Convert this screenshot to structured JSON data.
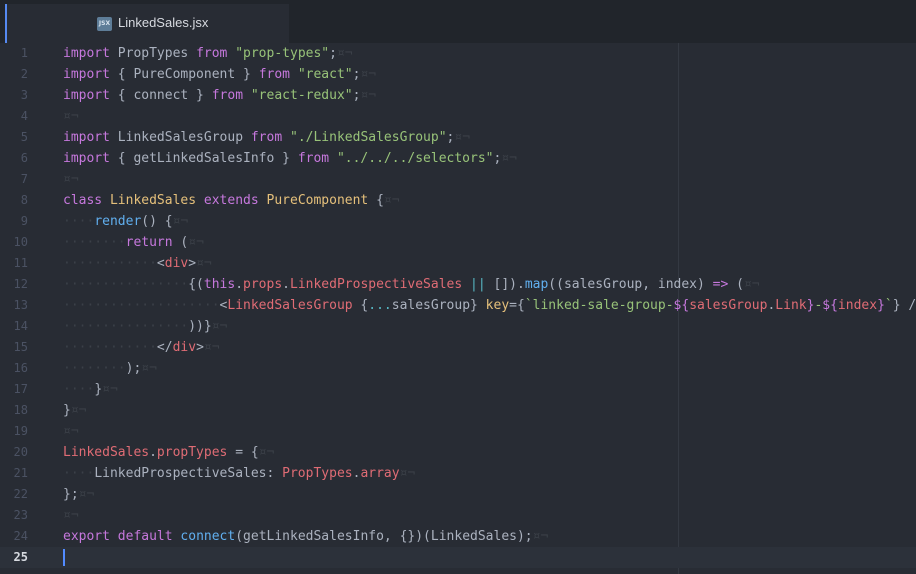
{
  "tab": {
    "icon_label": "JSX",
    "filename": "LinkedSales.jsx"
  },
  "editor": {
    "active_line": 25,
    "lines": [
      {
        "n": "1",
        "tokens": [
          [
            "k",
            "import"
          ],
          [
            "p",
            " PropTypes "
          ],
          [
            "k",
            "from"
          ],
          [
            "p",
            " "
          ],
          [
            "s",
            "\"prop-types\""
          ],
          [
            "p",
            ";"
          ],
          [
            "ws",
            "¤¬"
          ]
        ]
      },
      {
        "n": "2",
        "tokens": [
          [
            "k",
            "import"
          ],
          [
            "p",
            " { PureComponent } "
          ],
          [
            "k",
            "from"
          ],
          [
            "p",
            " "
          ],
          [
            "s",
            "\"react\""
          ],
          [
            "p",
            ";"
          ],
          [
            "ws",
            "¤¬"
          ]
        ]
      },
      {
        "n": "3",
        "tokens": [
          [
            "k",
            "import"
          ],
          [
            "p",
            " { connect } "
          ],
          [
            "k",
            "from"
          ],
          [
            "p",
            " "
          ],
          [
            "s",
            "\"react-redux\""
          ],
          [
            "p",
            ";"
          ],
          [
            "ws",
            "¤¬"
          ]
        ]
      },
      {
        "n": "4",
        "tokens": [
          [
            "ws",
            "¤¬"
          ]
        ]
      },
      {
        "n": "5",
        "tokens": [
          [
            "k",
            "import"
          ],
          [
            "p",
            " LinkedSalesGroup "
          ],
          [
            "k",
            "from"
          ],
          [
            "p",
            " "
          ],
          [
            "s",
            "\"./LinkedSalesGroup\""
          ],
          [
            "p",
            ";"
          ],
          [
            "ws",
            "¤¬"
          ]
        ]
      },
      {
        "n": "6",
        "tokens": [
          [
            "k",
            "import"
          ],
          [
            "p",
            " { getLinkedSalesInfo } "
          ],
          [
            "k",
            "from"
          ],
          [
            "p",
            " "
          ],
          [
            "s",
            "\"../../../selectors\""
          ],
          [
            "p",
            ";"
          ],
          [
            "ws",
            "¤¬"
          ]
        ]
      },
      {
        "n": "7",
        "tokens": [
          [
            "ws",
            "¤¬"
          ]
        ]
      },
      {
        "n": "8",
        "tokens": [
          [
            "k",
            "class"
          ],
          [
            "p",
            " "
          ],
          [
            "c",
            "LinkedSales"
          ],
          [
            "p",
            " "
          ],
          [
            "k",
            "extends"
          ],
          [
            "p",
            " "
          ],
          [
            "c",
            "PureComponent"
          ],
          [
            "p",
            " {"
          ],
          [
            "ws",
            "¤¬"
          ]
        ]
      },
      {
        "n": "9",
        "tokens": [
          [
            "ws",
            "····"
          ],
          [
            "f",
            "render"
          ],
          [
            "p",
            "() {"
          ],
          [
            "ws",
            "¤¬"
          ]
        ]
      },
      {
        "n": "10",
        "tokens": [
          [
            "ws",
            "········"
          ],
          [
            "k",
            "return"
          ],
          [
            "p",
            " ("
          ],
          [
            "ws",
            "¤¬"
          ]
        ]
      },
      {
        "n": "11",
        "tokens": [
          [
            "ws",
            "············"
          ],
          [
            "p",
            "<"
          ],
          [
            "t",
            "div"
          ],
          [
            "p",
            ">"
          ],
          [
            "ws",
            "¤¬"
          ]
        ]
      },
      {
        "n": "12",
        "tokens": [
          [
            "ws",
            "················"
          ],
          [
            "p",
            "{("
          ],
          [
            "k",
            "this"
          ],
          [
            "p",
            "."
          ],
          [
            "t",
            "props"
          ],
          [
            "p",
            "."
          ],
          [
            "t",
            "LinkedProspectiveSales"
          ],
          [
            "p",
            " "
          ],
          [
            "o",
            "||"
          ],
          [
            "p",
            " [])."
          ],
          [
            "f",
            "map"
          ],
          [
            "p",
            "((salesGroup, index) "
          ],
          [
            "k",
            "=>"
          ],
          [
            "p",
            " ("
          ],
          [
            "ws",
            "¤¬"
          ]
        ]
      },
      {
        "n": "13",
        "tokens": [
          [
            "ws",
            "····················"
          ],
          [
            "p",
            "<"
          ],
          [
            "t",
            "LinkedSalesGroup"
          ],
          [
            "p",
            " {"
          ],
          [
            "o",
            "..."
          ],
          [
            "p",
            "salesGroup} "
          ],
          [
            "c",
            "key"
          ],
          [
            "p",
            "={"
          ],
          [
            "s",
            "`linked-sale-group-"
          ],
          [
            "k",
            "${"
          ],
          [
            "t",
            "salesGroup"
          ],
          [
            "p",
            "."
          ],
          [
            "t",
            "Link"
          ],
          [
            "k",
            "}"
          ],
          [
            "s",
            "-"
          ],
          [
            "k",
            "${"
          ],
          [
            "t",
            "index"
          ],
          [
            "k",
            "}"
          ],
          [
            "s",
            "`"
          ],
          [
            "p",
            "} />"
          ],
          [
            "ws",
            "¤¬"
          ]
        ]
      },
      {
        "n": "14",
        "tokens": [
          [
            "ws",
            "················"
          ],
          [
            "p",
            "))}"
          ],
          [
            "ws",
            "¤¬"
          ]
        ]
      },
      {
        "n": "15",
        "tokens": [
          [
            "ws",
            "············"
          ],
          [
            "p",
            "</"
          ],
          [
            "t",
            "div"
          ],
          [
            "p",
            ">"
          ],
          [
            "ws",
            "¤¬"
          ]
        ]
      },
      {
        "n": "16",
        "tokens": [
          [
            "ws",
            "········"
          ],
          [
            "p",
            ");"
          ],
          [
            "ws",
            "¤¬"
          ]
        ]
      },
      {
        "n": "17",
        "tokens": [
          [
            "ws",
            "····"
          ],
          [
            "p",
            "}"
          ],
          [
            "ws",
            "¤¬"
          ]
        ]
      },
      {
        "n": "18",
        "tokens": [
          [
            "p",
            "}"
          ],
          [
            "ws",
            "¤¬"
          ]
        ]
      },
      {
        "n": "19",
        "tokens": [
          [
            "ws",
            "¤¬"
          ]
        ]
      },
      {
        "n": "20",
        "tokens": [
          [
            "t",
            "LinkedSales"
          ],
          [
            "p",
            "."
          ],
          [
            "t",
            "propTypes"
          ],
          [
            "p",
            " = {"
          ],
          [
            "ws",
            "¤¬"
          ]
        ]
      },
      {
        "n": "21",
        "tokens": [
          [
            "ws",
            "····"
          ],
          [
            "p",
            "LinkedProspectiveSales: "
          ],
          [
            "t",
            "PropTypes"
          ],
          [
            "p",
            "."
          ],
          [
            "t",
            "array"
          ],
          [
            "ws",
            "¤¬"
          ]
        ]
      },
      {
        "n": "22",
        "tokens": [
          [
            "p",
            "};"
          ],
          [
            "ws",
            "¤¬"
          ]
        ]
      },
      {
        "n": "23",
        "tokens": [
          [
            "ws",
            "¤¬"
          ]
        ]
      },
      {
        "n": "24",
        "tokens": [
          [
            "k",
            "export"
          ],
          [
            "p",
            " "
          ],
          [
            "k",
            "default"
          ],
          [
            "p",
            " "
          ],
          [
            "f",
            "connect"
          ],
          [
            "p",
            "(getLinkedSalesInfo, {})(LinkedSales);"
          ],
          [
            "ws",
            "¤¬"
          ]
        ]
      },
      {
        "n": "25",
        "tokens": []
      }
    ]
  }
}
